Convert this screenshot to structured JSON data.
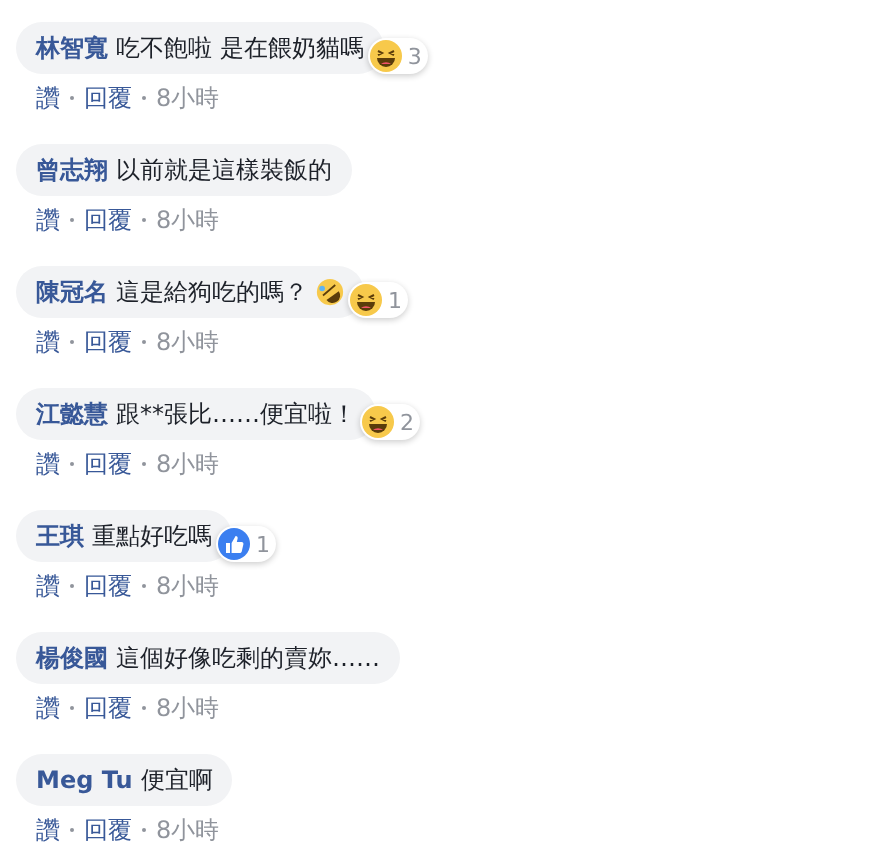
{
  "comments": [
    {
      "author": "林智寬",
      "text": "吃不飽啦 是在餵奶貓嗎",
      "reaction": {
        "kind": "haha",
        "count": "3"
      },
      "actions": [
        "讚",
        "回覆"
      ],
      "time": "8小時"
    },
    {
      "author": "曾志翔",
      "text": "以前就是這樣裝飯的",
      "actions": [
        "讚",
        "回覆"
      ],
      "time": "8小時"
    },
    {
      "author": "陳冠名",
      "text": "這是給狗吃的嗎？",
      "inline_emoji": {
        "kind": "rofl"
      },
      "reaction": {
        "kind": "haha",
        "count": "1"
      },
      "actions": [
        "讚",
        "回覆"
      ],
      "time": "8小時"
    },
    {
      "author": "江懿慧",
      "text": "跟**張比……便宜啦！",
      "reaction": {
        "kind": "haha",
        "count": "2"
      },
      "actions": [
        "讚",
        "回覆"
      ],
      "time": "8小時"
    },
    {
      "author": "王琪",
      "text": "重點好吃嗎",
      "reaction": {
        "kind": "like",
        "count": "1"
      },
      "actions": [
        "讚",
        "回覆"
      ],
      "time": "8小時"
    },
    {
      "author": "楊俊國",
      "text": "這個好像吃剩的賣妳……",
      "actions": [
        "讚",
        "回覆"
      ],
      "time": "8小時"
    },
    {
      "author": "Meg Tu",
      "text": "便宜啊",
      "actions": [
        "讚",
        "回覆"
      ],
      "time": "8小時"
    }
  ]
}
